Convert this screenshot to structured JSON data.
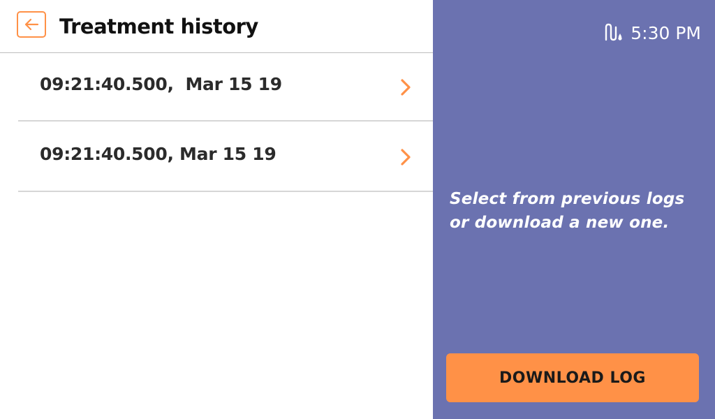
{
  "header": {
    "title": "Treatment history",
    "back_icon": "arrow-left-icon"
  },
  "logs": [
    {
      "label": "09:21:40.500,  Mar 15 19"
    },
    {
      "label": "09:21:40.500, Mar 15 19"
    }
  ],
  "status": {
    "icon": "connection-status-icon",
    "time": "5:30 PM"
  },
  "side_panel": {
    "instruction": "Select from previous logs or download a new one.",
    "download_label": "DOWNLOAD LOG"
  },
  "colors": {
    "accent": "#ff9147",
    "side_panel_bg": "#6b72b0",
    "divider": "#d6d6d6"
  }
}
